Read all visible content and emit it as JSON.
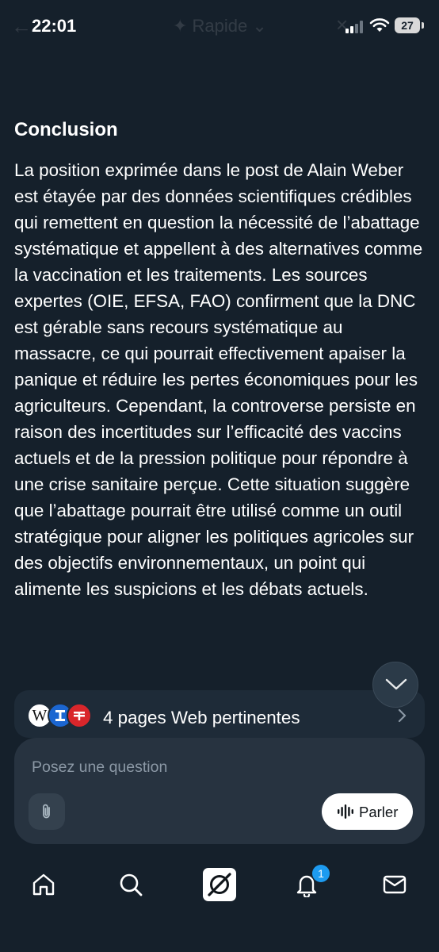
{
  "status_bar": {
    "time": "22:01",
    "battery": "27"
  },
  "header": {
    "mode_label": "Rapide"
  },
  "content": {
    "heading": "Conclusion",
    "paragraph": "La position exprimée dans le post de Alain Weber est étayée par des données scientifiques crédibles qui remettent en question la nécessité de l’abattage systématique et appellent à des alternatives comme la vaccination et les traitements. Les sources expertes (OIE, EFSA, FAO) confirment que la DNC est gérable sans recours systématique au massacre, ce qui pourrait effectivement apaiser la panique et réduire les pertes économiques pour les agriculteurs. Cependant, la controverse persiste en raison des incertitudes sur l’efficacité des vaccins actuels et de la pression politique pour répondre à une crise sanitaire perçue. Cette situation suggère que l’abattage pourrait être utilisé comme un outil stratégique pour aligner les politiques agricoles sur des objectifs environnementaux, un point qui alimente les suspicions et les débats actuels."
  },
  "sources": {
    "label": "4 pages Web pertinentes",
    "wiki_glyph": "W"
  },
  "composer": {
    "placeholder": "Posez une question",
    "talk_label": "Parler"
  },
  "nav": {
    "notification_count": "1"
  },
  "icons": {
    "back": "back-arrow-icon",
    "mode": "sparkle-icon",
    "close": "close-icon",
    "scroll": "chevron-down-icon",
    "sources_chevron": "chevron-right-icon",
    "attach": "paperclip-icon",
    "talk": "waveform-icon",
    "home": "home-icon",
    "search": "search-icon",
    "grok": "grok-icon",
    "notifications": "bell-icon",
    "messages": "mail-icon"
  },
  "colors": {
    "background": "#15202b",
    "accent": "#1d9bf0",
    "composer": "#273340"
  }
}
